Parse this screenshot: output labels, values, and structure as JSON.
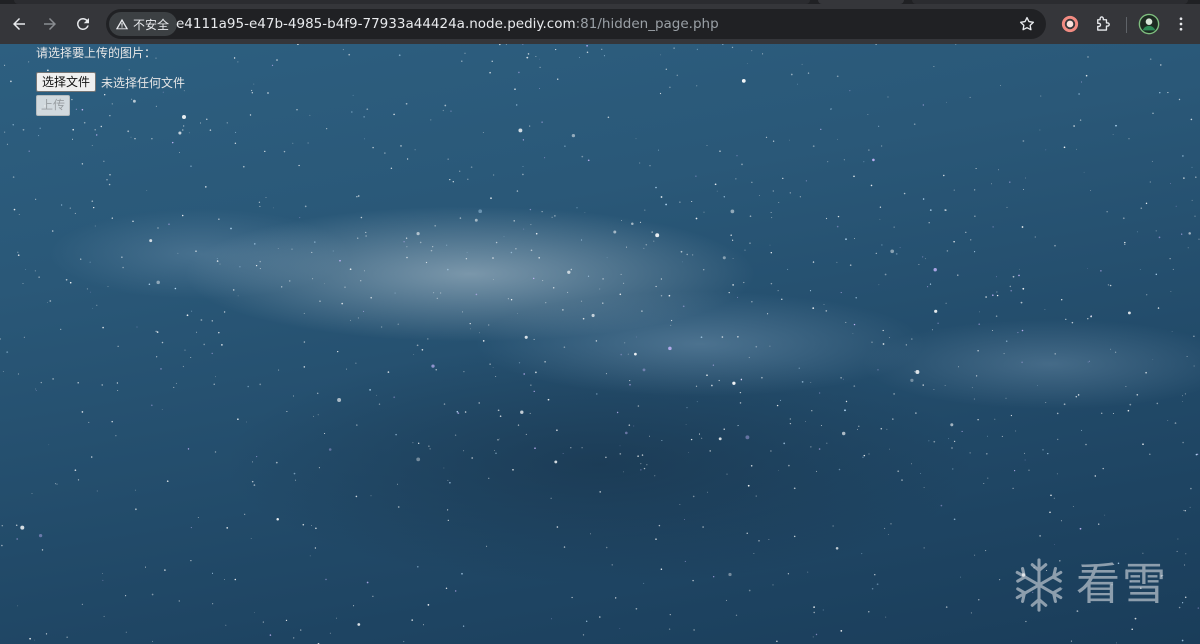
{
  "browser": {
    "security_label": "不安全",
    "url_host": "e4111a95-e47b-4985-b4f9-77933a44424a.node.pediy.com",
    "url_path": ":81/hidden_page.php"
  },
  "icons": {
    "back": "arrow-left-icon",
    "forward": "arrow-right-icon",
    "reload": "reload-icon",
    "warning": "warning-triangle-icon",
    "bookmark": "star-icon",
    "extension_a": "orange-ring-extension-icon",
    "extensions": "puzzle-icon",
    "profile": "avatar",
    "menu": "kebab-menu-icon"
  },
  "form": {
    "prompt": "请选择要上传的图片：",
    "choose_file_label": "选择文件",
    "no_file_label": "未选择任何文件",
    "upload_label": "上传"
  },
  "watermark": {
    "text": "看雪"
  },
  "colors": {
    "chrome_toolbar": "#35363a",
    "omnibox": "#202124",
    "sky_deep": "#1a3d5a",
    "sky_light": "#2d5f80",
    "accent_orange": "#f28b82"
  }
}
